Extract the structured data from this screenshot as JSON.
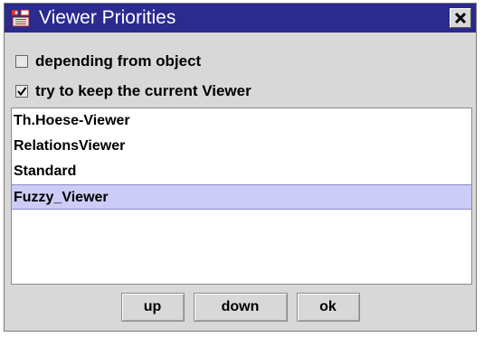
{
  "window": {
    "title": "Viewer Priorities",
    "icon": "app-icon",
    "close_icon": "close-icon",
    "colors": {
      "titlebar": "#2a2a8f",
      "body": "#d8d8d8",
      "selection": "#ccccf6"
    }
  },
  "options": {
    "depending_label": "depending from object",
    "depending_checked": false,
    "keep_label": "try to keep the current Viewer",
    "keep_checked": true
  },
  "viewers": [
    {
      "label": "Th.Hoese-Viewer",
      "selected": false
    },
    {
      "label": "RelationsViewer",
      "selected": false
    },
    {
      "label": "Standard",
      "selected": false
    },
    {
      "label": "Fuzzy_Viewer",
      "selected": true
    }
  ],
  "buttons": {
    "up_label": "up",
    "down_label": "down",
    "ok_label": "ok"
  }
}
